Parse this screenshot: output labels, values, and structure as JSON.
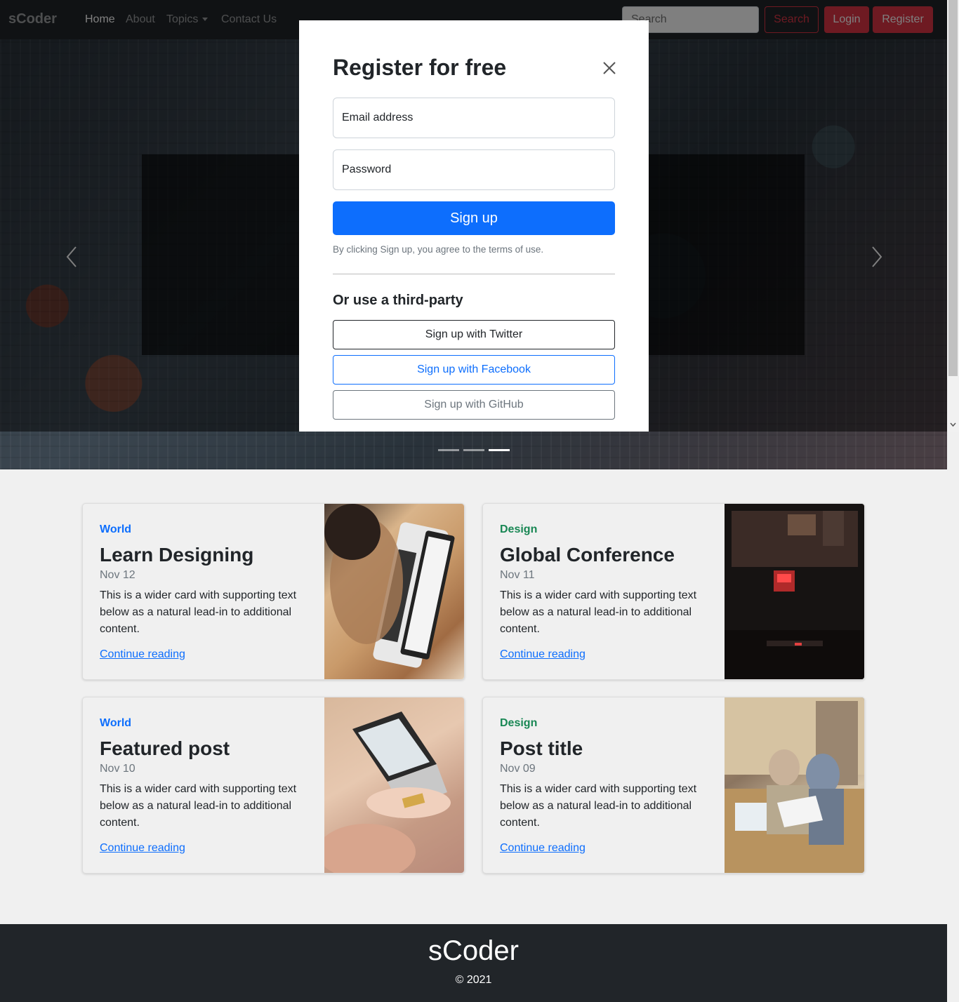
{
  "navbar": {
    "brand": "sCoder",
    "links": [
      {
        "label": "Home"
      },
      {
        "label": "About"
      },
      {
        "label": "Topics"
      },
      {
        "label": "Contact Us"
      }
    ],
    "search_placeholder": "Search",
    "search_button": "Search",
    "login_button": "Login",
    "register_button": "Register"
  },
  "modal": {
    "title": "Register for free",
    "email_placeholder": "Email address",
    "password_placeholder": "Password",
    "signup_button": "Sign up",
    "terms": "By clicking Sign up, you agree to the terms of use.",
    "third_party_title": "Or use a third-party",
    "twitter_button": "Sign up with Twitter",
    "facebook_button": "Sign up with Facebook",
    "github_button": "Sign up with GitHub"
  },
  "carousel": {
    "slide_count": 3,
    "active_slide": 3
  },
  "cards": [
    {
      "category": "World",
      "title": "Learn Designing",
      "date": "Nov 12",
      "text": "This is a wider card with supporting text below as a natural lead-in to additional content.",
      "link": "Continue reading"
    },
    {
      "category": "Design",
      "title": "Global Conference",
      "date": "Nov 11",
      "text": "This is a wider card with supporting text below as a natural lead-in to additional content.",
      "link": "Continue reading"
    },
    {
      "category": "World",
      "title": "Featured post",
      "date": "Nov 10",
      "text": "This is a wider card with supporting text below as a natural lead-in to additional content.",
      "link": "Continue reading"
    },
    {
      "category": "Design",
      "title": "Post title",
      "date": "Nov 09",
      "text": "This is a wider card with supporting text below as a natural lead-in to additional content.",
      "link": "Continue reading"
    }
  ],
  "footer": {
    "brand": "sCoder",
    "copyright": "© 2021"
  },
  "colors": {
    "primary": "#0d6efd",
    "danger": "#dc3545",
    "success": "#198754",
    "dark": "#212529"
  }
}
